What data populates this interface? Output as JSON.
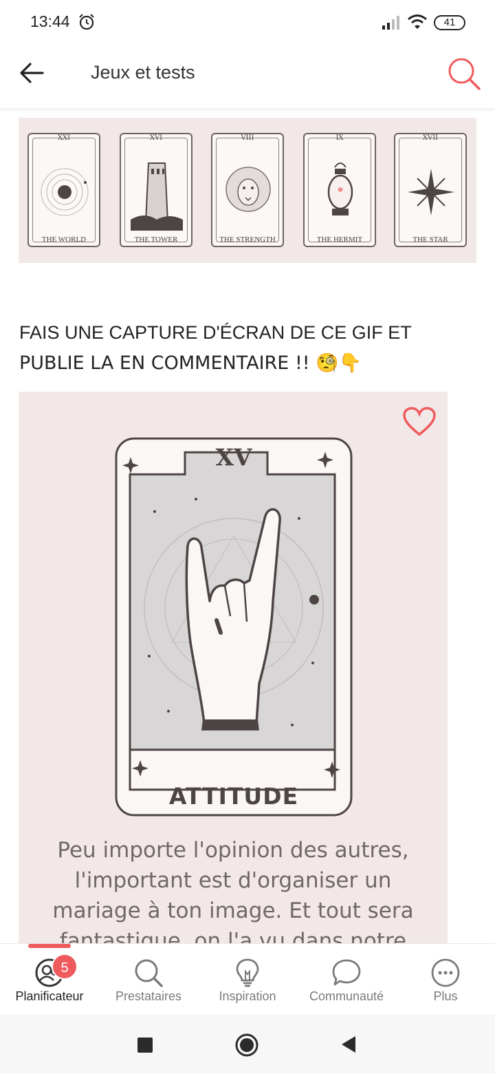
{
  "status_bar": {
    "time": "13:44",
    "battery": "41"
  },
  "app_bar": {
    "title": "Jeux et tests"
  },
  "banner_cards": [
    {
      "numeral": "XXI",
      "label": "THE WORLD",
      "icon": "planet-icon"
    },
    {
      "numeral": "XVI",
      "label": "THE TOWER",
      "icon": "tower-icon"
    },
    {
      "numeral": "VIII",
      "label": "THE STRENGTH",
      "icon": "lion-icon"
    },
    {
      "numeral": "IX",
      "label": "THE HERMIT",
      "icon": "lantern-icon"
    },
    {
      "numeral": "XVII",
      "label": "THE STAR",
      "icon": "star-icon"
    }
  ],
  "post": {
    "heading_line1": "FAIS UNE CAPTURE D'ÉCRAN DE CE GIF ET",
    "heading_line2": "PUBLIE LA EN COMMENTAIRE !! 🧐👇"
  },
  "gif": {
    "numeral": "XV",
    "name": "ATTITUDE",
    "caption_line1": "Peu importe l'opinion des autres,",
    "caption_line2": "l'important est d'organiser un",
    "caption_line3": "mariage à ton image. Et tout sera",
    "caption_line4": "fantastique, on l'a vu dans notre"
  },
  "bottom_nav": [
    {
      "label": "Planificateur",
      "icon": "planner-icon",
      "active": true,
      "badge": "5"
    },
    {
      "label": "Prestataires",
      "icon": "search-icon"
    },
    {
      "label": "Inspiration",
      "icon": "lightbulb-icon"
    },
    {
      "label": "Communauté",
      "icon": "chat-bubble-icon"
    },
    {
      "label": "Plus",
      "icon": "more-icon"
    }
  ],
  "colors": {
    "accent": "#ef5a5c",
    "card_bg": "#f1e8e7",
    "ink": "#4d4543"
  }
}
